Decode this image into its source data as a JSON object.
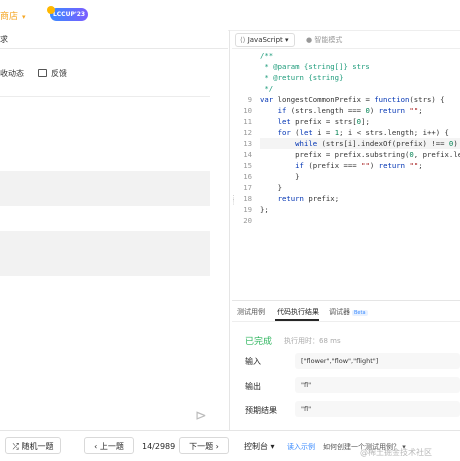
{
  "header": {
    "shop": "商店",
    "shop_chevron": "▾",
    "badge": "LCCUP'23"
  },
  "left": {
    "header_fragment": "求",
    "tabs": [
      {
        "label": "收动态"
      },
      {
        "label": "反馈"
      }
    ]
  },
  "editor": {
    "language": "JavaScript",
    "lang_chevron": "▾",
    "smart_mode": "智能模式",
    "line_numbers": [
      "9",
      "10",
      "11",
      "12",
      "13",
      "14",
      "15",
      "16",
      "17",
      "18",
      "19",
      "20"
    ]
  },
  "results": {
    "tabs": [
      {
        "label": "测试用例"
      },
      {
        "label": "代码执行结果"
      },
      {
        "label": "调试器"
      }
    ],
    "beta": "Beta",
    "status": "已完成",
    "runtime": "执行用时：68 ms",
    "input_label": "输入",
    "input_value": "[\"flower\",\"flow\",\"flight\"]",
    "output_label": "输出",
    "output_value": "\"fl\"",
    "expected_label": "预期结果",
    "expected_value": "\"fl\""
  },
  "bottom": {
    "random": "随机一题",
    "prev": "上一题",
    "page": "14/2989",
    "next": "下一题",
    "console": "控制台",
    "example": "读入示例",
    "how_to": "如何创建一个测试用例？"
  },
  "watermark": "@稀土掘金技术社区"
}
